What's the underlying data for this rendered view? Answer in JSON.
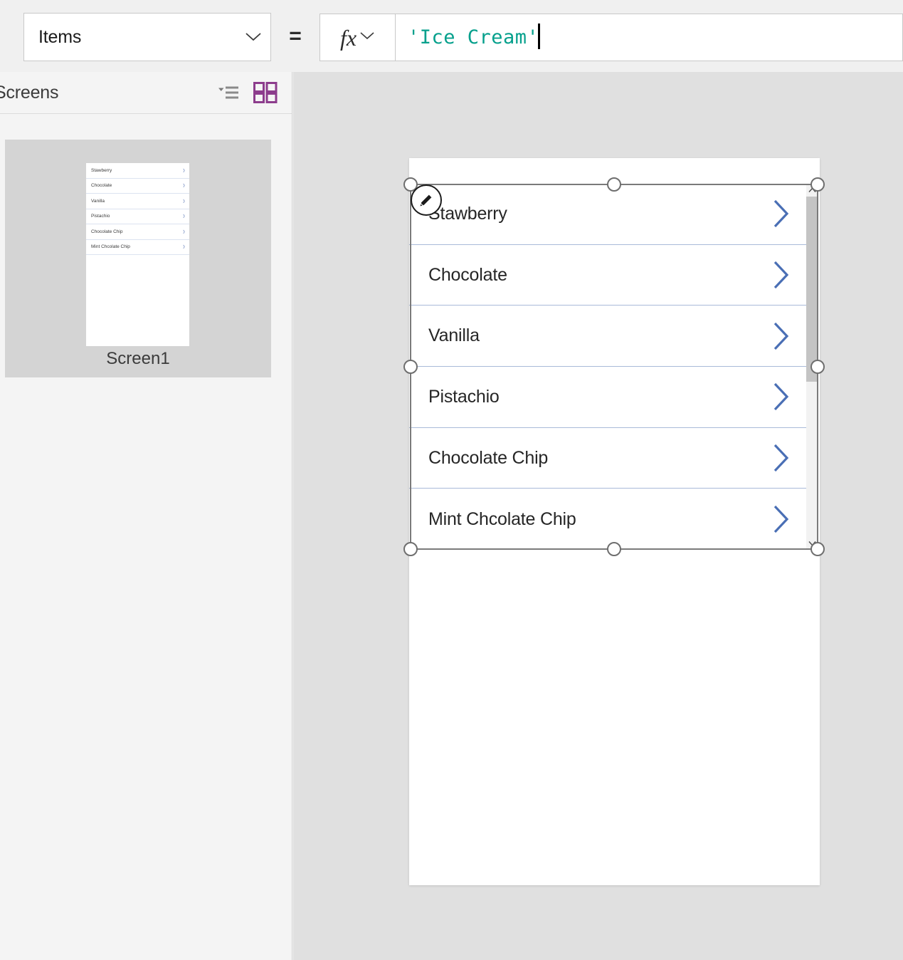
{
  "formula_bar": {
    "property_dropdown": {
      "value": "Items",
      "chevron_icon": "chevron-down-icon"
    },
    "equals": "=",
    "fx_button": {
      "glyph": "fx",
      "chevron_icon": "chevron-down-icon"
    },
    "formula": {
      "value": "'Ice Cream'",
      "text_color": "#05a08c",
      "caret_visible": true
    }
  },
  "screens_panel": {
    "title": "Screens",
    "tree_view_icon": "tree-view-icon",
    "grid_view_icon": "grid-view-icon",
    "grid_view_active": true,
    "accent_color": "#8c3c8c",
    "screens": [
      {
        "name": "Screen1",
        "selected": true,
        "thumbnail_items": [
          "Stawberry",
          "Chocolate",
          "Vanilla",
          "Pistachio",
          "Chocolate Chip",
          "Mint Chcolate Chip"
        ]
      }
    ]
  },
  "canvas": {
    "background_color": "#e0e0e0",
    "screen_background": "#ffffff",
    "gallery": {
      "selected": true,
      "edit_badge_icon": "pencil-edit-icon",
      "chevron_icon": "chevron-right-icon",
      "chevron_color": "#4a6fb5",
      "separator_color": "#a9bad9",
      "items": [
        {
          "label": "Stawberry"
        },
        {
          "label": "Chocolate"
        },
        {
          "label": "Vanilla"
        },
        {
          "label": "Pistachio"
        },
        {
          "label": "Chocolate Chip"
        },
        {
          "label": "Mint Chcolate Chip"
        }
      ],
      "scrollbar": {
        "up_arrow_icon": "chevron-up-icon",
        "down_arrow_icon": "chevron-down-icon",
        "thumb_color": "#c4c4c4"
      }
    }
  }
}
